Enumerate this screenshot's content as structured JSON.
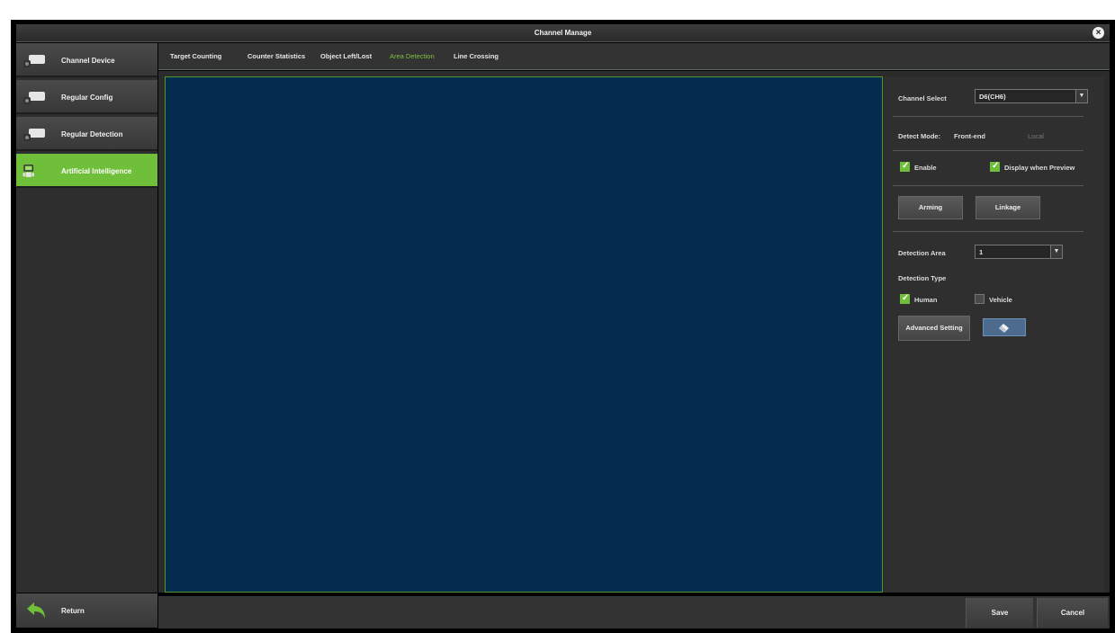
{
  "window": {
    "title": "Channel Manage"
  },
  "sidebar": {
    "items": [
      {
        "label": "Channel Device",
        "active": false
      },
      {
        "label": "Regular Config",
        "active": false
      },
      {
        "label": "Regular Detection",
        "active": false
      },
      {
        "label": "Artificial Intelligence",
        "active": true
      }
    ],
    "return_label": "Return"
  },
  "tabs": [
    {
      "label": "Target Counting",
      "active": false
    },
    {
      "label": "Counter Statistics",
      "active": false
    },
    {
      "label": "Object Left/Lost",
      "active": false
    },
    {
      "label": "Area Detection",
      "active": true
    },
    {
      "label": "Line Crossing",
      "active": false
    }
  ],
  "panel": {
    "channel_select_label": "Channel Select",
    "channel_select_value": "D6(CH6)",
    "detect_mode_label": "Detect Mode:",
    "detect_mode_frontend": "Front-end",
    "detect_mode_local": "Local",
    "enable_label": "Enable",
    "enable_checked": true,
    "display_preview_label": "Display when Preview",
    "display_preview_checked": true,
    "arming_label": "Arming",
    "linkage_label": "Linkage",
    "detection_area_label": "Detection Area",
    "detection_area_value": "1",
    "detection_type_label": "Detection Type",
    "human_label": "Human",
    "human_checked": true,
    "vehicle_label": "Vehicle",
    "vehicle_checked": false,
    "advanced_setting_label": "Advanced Setting",
    "eraser_icon": "eraser-icon"
  },
  "footer": {
    "save_label": "Save",
    "cancel_label": "Cancel"
  },
  "colors": {
    "accent": "#6fbf3b",
    "preview_bg": "#032c4e",
    "active_tab": "#7cc43f"
  }
}
